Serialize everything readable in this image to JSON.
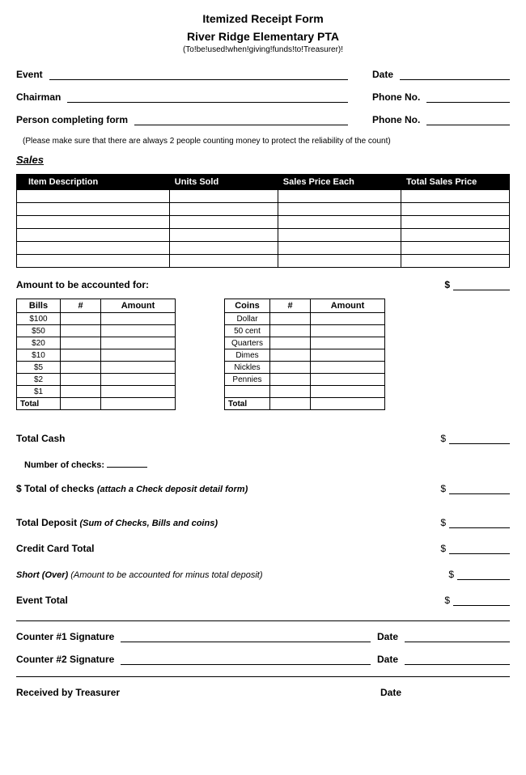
{
  "header": {
    "title": "Itemized Receipt Form",
    "org": "River Ridge Elementary PTA",
    "note": "(To!be!used!when!giving!funds!to!Treasurer)!"
  },
  "fields": {
    "event": "Event",
    "date": "Date",
    "chairman": "Chairman",
    "phone1": "Phone No.",
    "person": "Person completing form",
    "phone2": "Phone No."
  },
  "instruction": "(Please make sure that there are always 2 people counting money to protect the reliability of the count)",
  "sales": {
    "heading": "Sales",
    "cols": [
      "Item Description",
      "Units Sold",
      "Sales Price Each",
      "Total Sales Price"
    ]
  },
  "account": {
    "label": "Amount to be accounted for:",
    "dollar": "$"
  },
  "bills": {
    "cols": [
      "Bills",
      "#",
      "Amount"
    ],
    "rows": [
      "$100",
      "$50",
      "$20",
      "$10",
      "$5",
      "$2",
      "$1"
    ],
    "total": "Total"
  },
  "coins": {
    "cols": [
      "Coins",
      "#",
      "Amount"
    ],
    "rows": [
      "Dollar",
      "50 cent",
      "Quarters",
      "Dimes",
      "Nickles",
      "Pennies"
    ],
    "total": "Total"
  },
  "totals": {
    "totalCash": "Total Cash",
    "numChecks": "Number of checks:",
    "totalChecksPrefix": "$ Total of checks ",
    "totalChecksNote": "(attach a Check deposit detail form)",
    "totalDeposit": "Total Deposit ",
    "totalDepositNote": "(Sum of Checks, Bills and coins)",
    "creditCard": "Credit Card Total",
    "shortOver": "Short (Over) ",
    "shortOverNote": "(Amount to be accounted for minus total deposit)",
    "eventTotal": "Event Total",
    "dollar": "$"
  },
  "sigs": {
    "c1": "Counter #1 Signature",
    "c2": "Counter #2 Signature",
    "date": "Date",
    "treasurer": "Received by Treasurer"
  }
}
